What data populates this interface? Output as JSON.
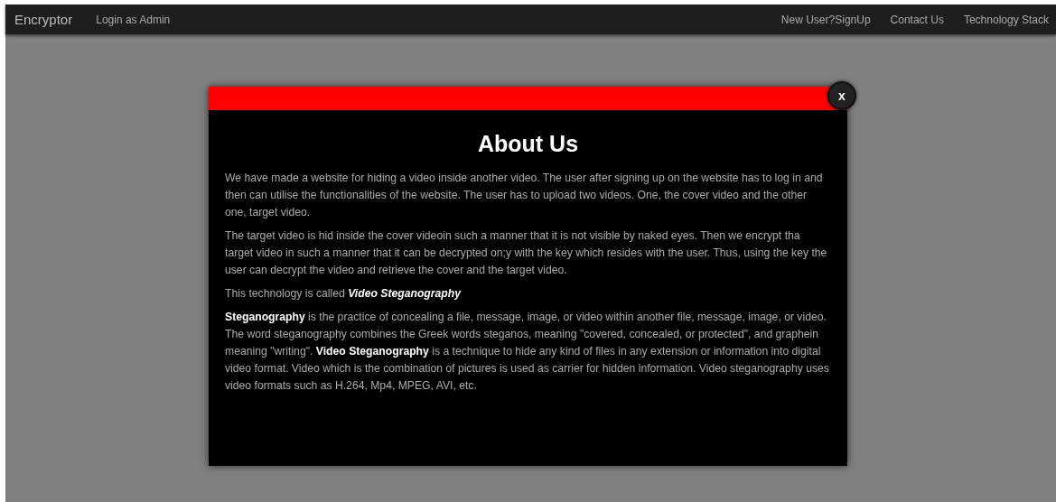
{
  "navbar": {
    "brand": "Encryptor",
    "left_links": [
      "Login as Admin"
    ],
    "right_links": [
      "New User?SignUp",
      "Contact Us",
      "Technology Stack"
    ]
  },
  "modal": {
    "close": "x",
    "title": "About Us",
    "paragraphs": [
      "We have made a website for hiding a video inside another video. The user after signing up on the website has to log in and then can utilise the functionalities of the website. The user has to upload two videos. One, the cover video and the other one, target video.",
      "The target video is hid inside the cover videoin such a manner that it is not visible by naked eyes. Then we encrypt tha target video in such a manner that it can be decrypted on;y with the key which resides with the user. Thus, using the key the user can decrypt the video and retrieve the cover and the target video.",
      {
        "text": "This technology is called",
        "emphasis": "Video Steganography"
      },
      "**Steganography** is the practice of concealing a file, message, image, or video within another file, message, image, or video. The word steganography combines the Greek words steganos, meaning \"covered, concealed, or protected\", and graphein meaning \"writing\". **Video Steganography** is a technique to hide any kind of files in any extension or information into digital video format. Video which is the combination of pictures is used as carrier for hidden information. Video steganography uses video formats such as H.264, Mp4, MPEG, AVI, etc."
    ]
  }
}
